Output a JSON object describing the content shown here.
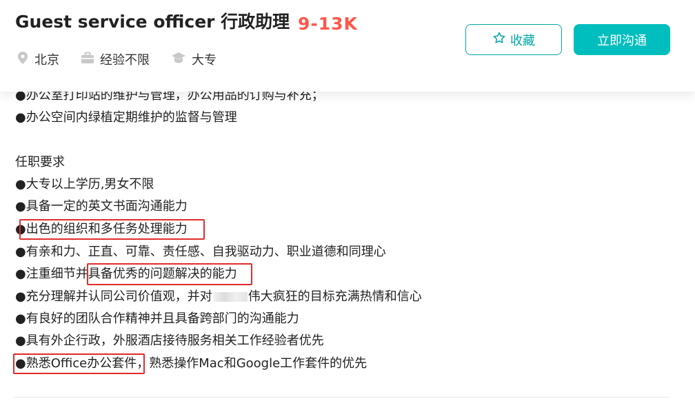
{
  "header": {
    "title": "Guest service officer 行政助理",
    "salary": "9-13K",
    "meta": {
      "location": "北京",
      "experience": "经验不限",
      "education": "大专"
    },
    "favorite_label": "收藏",
    "chat_label": "立即沟通"
  },
  "description": {
    "partial_line": "●办公室打印站的维护与管理，办公用品的订购与补充；",
    "duty_last": "●办公空间内绿植定期维护的监督与管理",
    "requirements_heading": "任职要求",
    "requirements": {
      "r1": "●大专以上学历,男女不限",
      "r2": "●具备一定的英文书面沟通能力",
      "r3_bullet": "●",
      "r3_highlight": "出色的组织和多任务处理能力",
      "r4": "●有亲和力、正直、可靠、责任感、自我驱动力、职业道德和同理心",
      "r5_prefix": "●注重细节并",
      "r5_highlight": "具备优秀的问题解决的能力",
      "r6_prefix": "●充分理解并认同公司价值观，并对",
      "r6_suffix": "伟大疯狂的目标充满热情和信心",
      "r7": "●有良好的团队合作精神并且具备跨部门的沟通能力",
      "r8": "●具有外企行政，外服酒店接待服务相关工作经验者优先",
      "r9_highlight": "●熟悉Office办公套件，",
      "r9_suffix": "熟悉操作Mac和Google工作套件的优先"
    }
  },
  "colors": {
    "accent": "#00bebd",
    "salary": "#fe574a",
    "annotation_box": "#e12b2b"
  },
  "icons": [
    "location-pin-icon",
    "briefcase-icon",
    "graduation-cap-icon",
    "star-outline-icon"
  ]
}
